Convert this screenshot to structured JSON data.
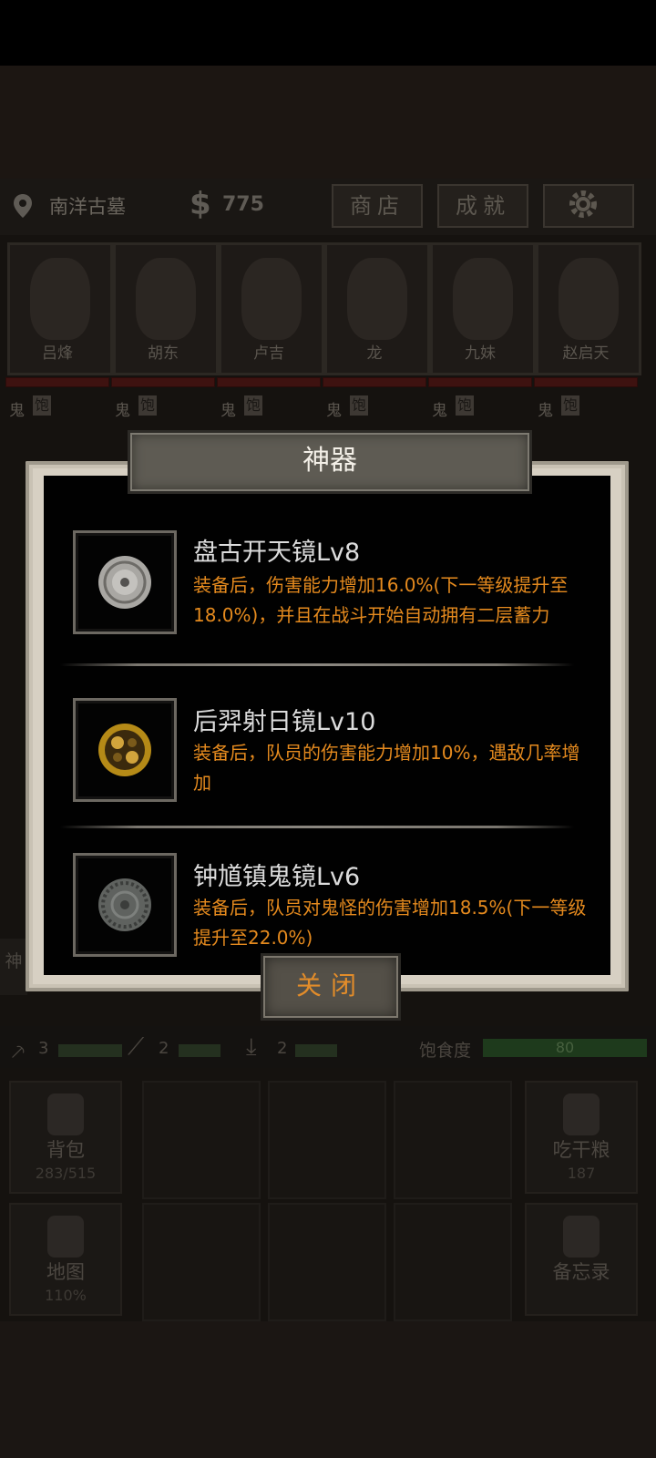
{
  "hud": {
    "location": "南洋古墓",
    "money_symbol": "$",
    "money": "775",
    "shop_label": "商店",
    "achievement_label": "成就",
    "settings_icon": "gear-icon"
  },
  "characters": [
    {
      "name": "吕烽",
      "status_ghost": "鬼",
      "status_full": "饱"
    },
    {
      "name": "胡东",
      "status_ghost": "鬼",
      "status_full": "饱"
    },
    {
      "name": "卢吉",
      "status_ghost": "鬼",
      "status_full": "饱"
    },
    {
      "name": "龙",
      "status_ghost": "鬼",
      "status_full": "饱"
    },
    {
      "name": "九妹",
      "status_ghost": "鬼",
      "status_full": "饱"
    },
    {
      "name": "赵启天",
      "status_ghost": "鬼",
      "status_full": "饱"
    }
  ],
  "side_tab": "神",
  "stats": {
    "tool1_count": "3",
    "tool2_count": "2",
    "tool3_count": "2",
    "hunger_label": "饱食度",
    "hunger_value": "80"
  },
  "tiles": {
    "backpack_label": "背包",
    "backpack_count": "283/515",
    "eat_label": "吃干粮",
    "eat_count": "187",
    "map_label": "地图",
    "map_count": "110%",
    "memo_label": "备忘录"
  },
  "modal": {
    "title": "神器",
    "items": [
      {
        "name": "盘古开天镜Lv8",
        "desc": "装备后，伤害能力增加16.0%(下一等级提升至18.0%)，并且在战斗开始自动拥有二层蓄力",
        "color": "#a9a7a3"
      },
      {
        "name": "后羿射日镜Lv10",
        "desc": "装备后，队员的伤害能力增加10%，遇敌几率增加",
        "color": "#b58a17"
      },
      {
        "name": "钟馗镇鬼镜Lv6",
        "desc": "装备后，队员对鬼怪的伤害增加18.5%(下一等级提升至22.0%)",
        "color": "#5f625f"
      }
    ],
    "close_label": "关闭"
  },
  "colors": {
    "accent": "#e58a1e",
    "name_text": "#dcdcdc"
  }
}
